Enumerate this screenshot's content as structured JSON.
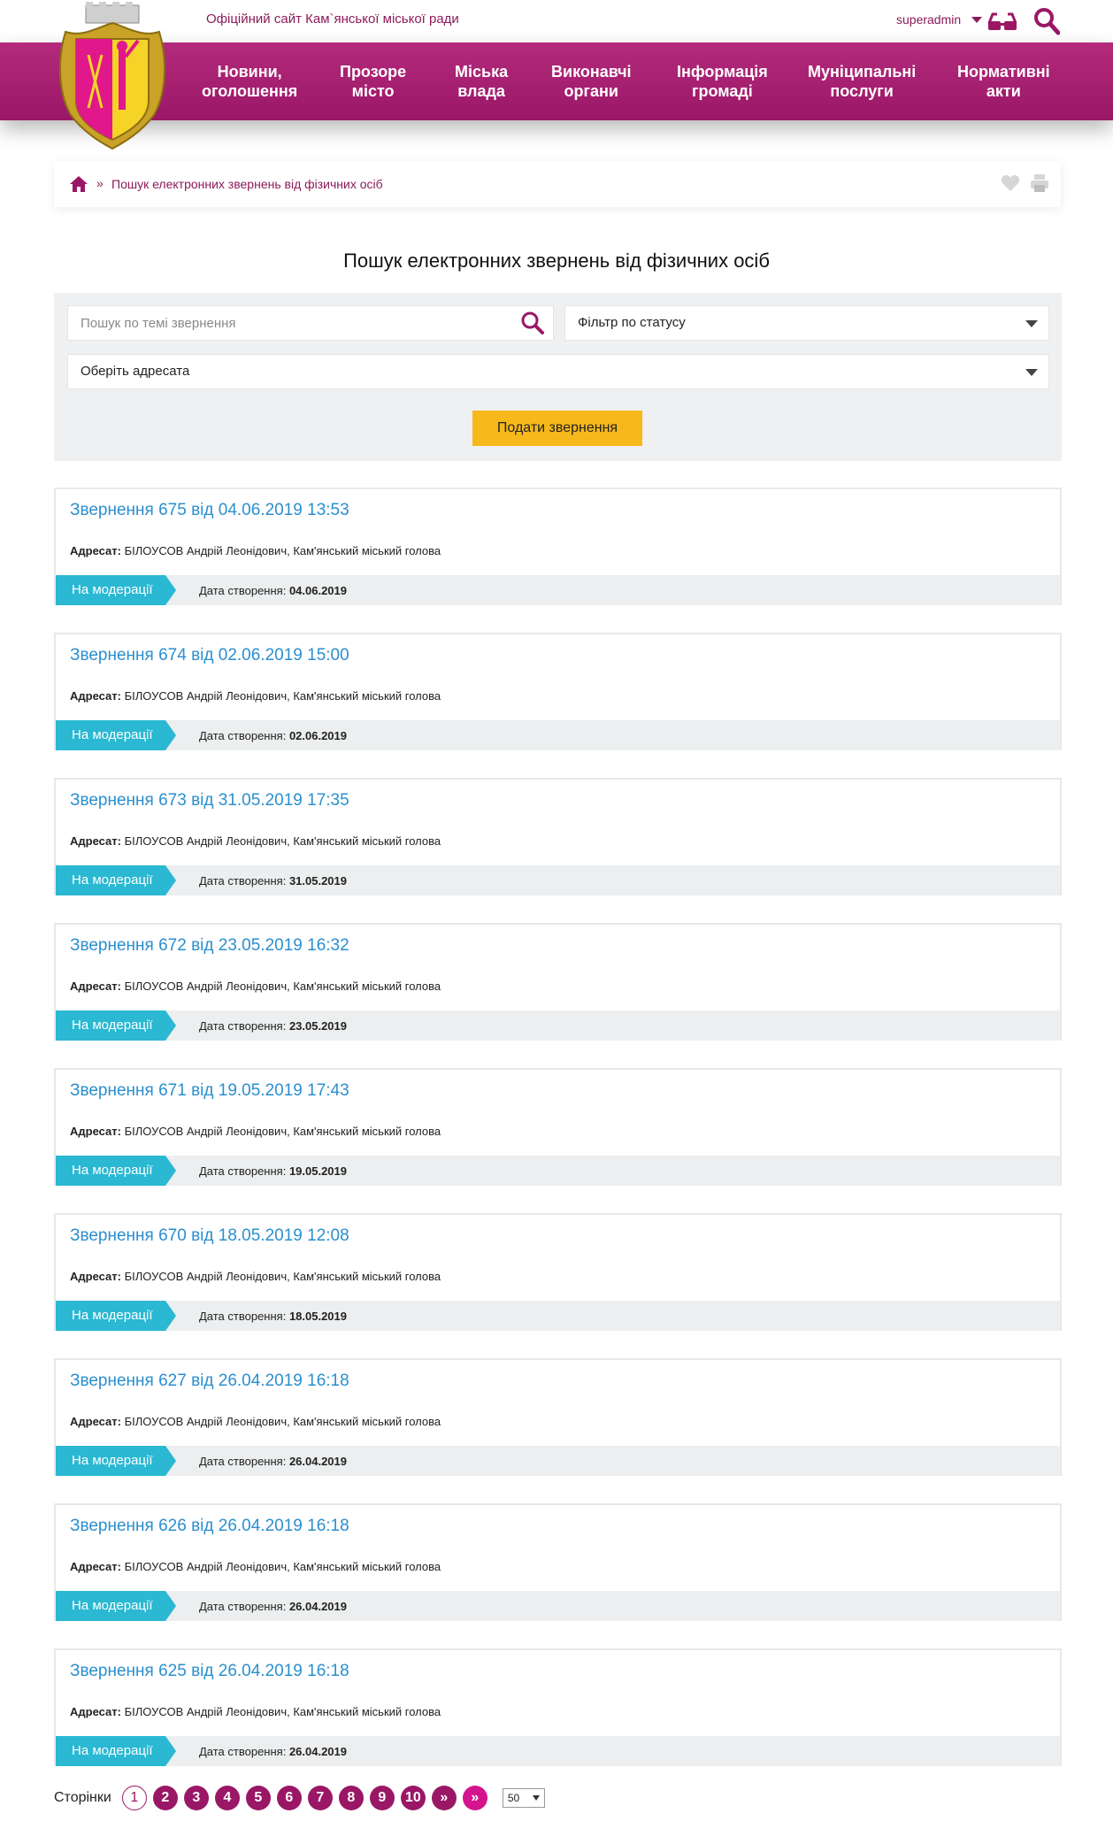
{
  "header": {
    "site_title": "Офіційний сайт Кам`янської міської ради",
    "username": "superadmin"
  },
  "nav": [
    {
      "line1": "Новини,",
      "line2": "оголошення"
    },
    {
      "line1": "Прозоре",
      "line2": "місто"
    },
    {
      "line1": "Міська",
      "line2": "влада"
    },
    {
      "line1": "Виконавчі",
      "line2": "органи"
    },
    {
      "line1": "Інформація",
      "line2": "громаді"
    },
    {
      "line1": "Муніципальні",
      "line2": "послуги"
    },
    {
      "line1": "Нормативні",
      "line2": "акти"
    }
  ],
  "breadcrumb": {
    "separator": "»",
    "current": "Пошук електронних звернень від фізичних осіб"
  },
  "page_title": "Пошук електронних звернень від фізичних осіб",
  "filters": {
    "search_placeholder": "Пошук по темі звернення",
    "status_filter": "Фільтр по статусу",
    "addressee": "Оберіть адресата",
    "submit_label": "Подати звернення"
  },
  "labels": {
    "addressee": "Адресат:",
    "created": "Дата створення:"
  },
  "appeals": [
    {
      "title": "Звернення 675 від 04.06.2019 13:53",
      "addressee": "БІЛОУСОВ Андрій Леонідович, Кам'янський міський голова",
      "status": "На модерації",
      "date": "04.06.2019"
    },
    {
      "title": "Звернення 674 від 02.06.2019 15:00",
      "addressee": "БІЛОУСОВ Андрій Леонідович, Кам'янський міський голова",
      "status": "На модерації",
      "date": "02.06.2019"
    },
    {
      "title": "Звернення 673 від 31.05.2019 17:35",
      "addressee": "БІЛОУСОВ Андрій Леонідович, Кам'янський міський голова",
      "status": "На модерації",
      "date": "31.05.2019"
    },
    {
      "title": "Звернення 672 від 23.05.2019 16:32",
      "addressee": "БІЛОУСОВ Андрій Леонідович, Кам'янський міський голова",
      "status": "На модерації",
      "date": "23.05.2019"
    },
    {
      "title": "Звернення 671 від 19.05.2019 17:43",
      "addressee": "БІЛОУСОВ Андрій Леонідович, Кам'янський міський голова",
      "status": "На модерації",
      "date": "19.05.2019"
    },
    {
      "title": "Звернення 670 від 18.05.2019 12:08",
      "addressee": "БІЛОУСОВ Андрій Леонідович, Кам'янський міський голова",
      "status": "На модерації",
      "date": "18.05.2019"
    },
    {
      "title": "Звернення 627 від 26.04.2019 16:18",
      "addressee": "БІЛОУСОВ Андрій Леонідович, Кам'янський міський голова",
      "status": "На модерації",
      "date": "26.04.2019"
    },
    {
      "title": "Звернення 626 від 26.04.2019 16:18",
      "addressee": "БІЛОУСОВ Андрій Леонідович, Кам'янський міський голова",
      "status": "На модерації",
      "date": "26.04.2019"
    },
    {
      "title": "Звернення 625 від 26.04.2019 16:18",
      "addressee": "БІЛОУСОВ Андрій Леонідович, Кам'янський міський голова",
      "status": "На модерації",
      "date": "26.04.2019"
    }
  ],
  "pagination": {
    "label": "Сторінки",
    "pages": [
      "1",
      "2",
      "3",
      "4",
      "5",
      "6",
      "7",
      "8",
      "9",
      "10"
    ],
    "current": "1",
    "next": "»",
    "last": "»",
    "per_page": "50"
  },
  "colors": {
    "brand": "#9a1766",
    "link": "#2a8fcf",
    "status": "#2ab8d2",
    "submit": "#f7b81b"
  }
}
